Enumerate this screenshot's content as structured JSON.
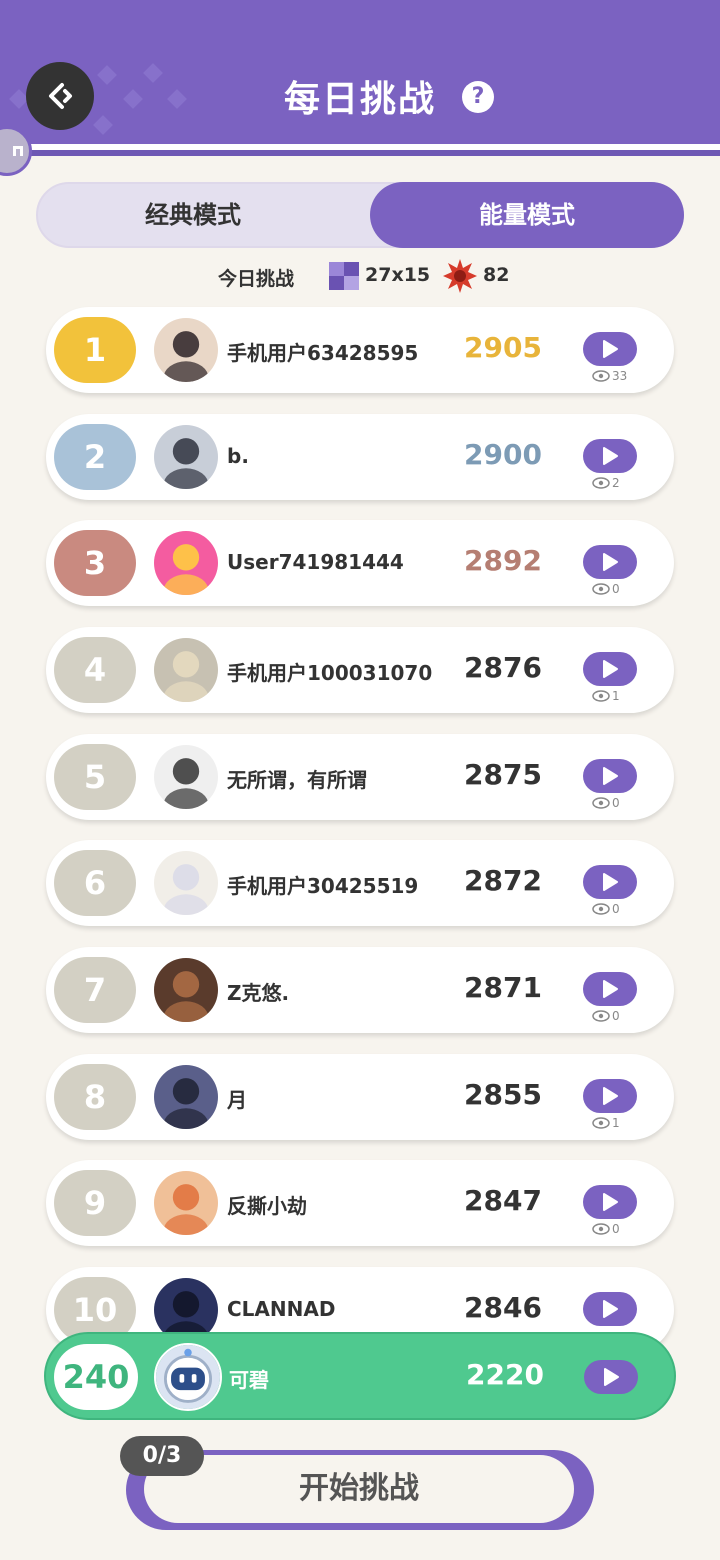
{
  "header": {
    "title": "每日挑战",
    "help_icon": "question-circle-icon",
    "back_icon": "back-arrow-icon"
  },
  "tabs": [
    {
      "label": "经典模式",
      "active": false
    },
    {
      "label": "能量模式",
      "active": true
    }
  ],
  "daily_info": {
    "label": "今日挑战",
    "grid_size": "27x15",
    "energy_count": "82"
  },
  "colors": {
    "accent": "#7b62c1",
    "gold": "#f2c23b",
    "silver": "#a9c2d8",
    "bronze": "#c98a80",
    "gray_rank": "#d3d0c4",
    "self_row": "#4fc98f"
  },
  "leaderboard": [
    {
      "rank": "1",
      "name": "手机用户63428595",
      "score": "2905",
      "views": "33"
    },
    {
      "rank": "2",
      "name": "b.",
      "score": "2900",
      "views": "2"
    },
    {
      "rank": "3",
      "name": "User741981444",
      "score": "2892",
      "views": "0"
    },
    {
      "rank": "4",
      "name": "手机用户100031070",
      "score": "2876",
      "views": "1"
    },
    {
      "rank": "5",
      "name": "无所谓，有所谓",
      "score": "2875",
      "views": "0"
    },
    {
      "rank": "6",
      "name": "手机用户30425519",
      "score": "2872",
      "views": "0"
    },
    {
      "rank": "7",
      "name": "Z克悠.",
      "score": "2871",
      "views": "0"
    },
    {
      "rank": "8",
      "name": "月",
      "score": "2855",
      "views": "1"
    },
    {
      "rank": "9",
      "name": "反撕小劫",
      "score": "2847",
      "views": "0"
    },
    {
      "rank": "10",
      "name": "CLANNAD",
      "score": "2846",
      "views": ""
    }
  ],
  "my_entry": {
    "rank": "240",
    "name": "可碧",
    "score": "2220"
  },
  "start": {
    "label": "开始挑战",
    "attempts": "0/3"
  }
}
